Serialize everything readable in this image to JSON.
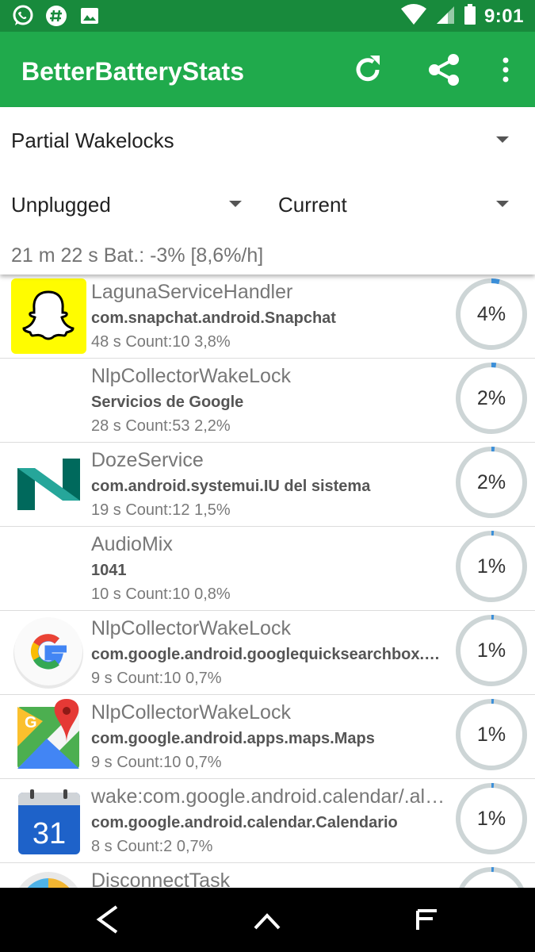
{
  "status_bar": {
    "time": "9:01",
    "left_icons": [
      "whatsapp-icon",
      "hashtag-icon",
      "image-icon"
    ],
    "right_icons": [
      "wifi-icon",
      "signal-icon",
      "battery-icon"
    ]
  },
  "app_bar": {
    "title": "BetterBatteryStats",
    "actions": [
      "refresh-icon",
      "share-icon",
      "more-vert-icon"
    ]
  },
  "filters": {
    "stat_type": "Partial Wakelocks",
    "reference_from": "Unplugged",
    "reference_to": "Current",
    "summary": "21 m 22 s  Bat.: -3% [8,6%/h]"
  },
  "wakelocks": [
    {
      "icon": "snapchat-icon",
      "name": "LagunaServiceHandler",
      "package": "com.snapchat.android.Snapchat",
      "meta": "48 s  Count:10 3,8%",
      "percent_label": "4%",
      "gauge_fraction": 0.038
    },
    {
      "icon": "",
      "name": "NlpCollectorWakeLock",
      "package": "Servicios de Google",
      "meta": "28 s  Count:53 2,2%",
      "percent_label": "2%",
      "gauge_fraction": 0.022
    },
    {
      "icon": "android-n-icon",
      "name": "DozeService",
      "package": "com.android.systemui.IU del sistema",
      "meta": "19 s  Count:12 1,5%",
      "percent_label": "2%",
      "gauge_fraction": 0.015
    },
    {
      "icon": "",
      "name": "AudioMix",
      "package": "1041",
      "meta": "10 s  Count:10 0,8%",
      "percent_label": "1%",
      "gauge_fraction": 0.008
    },
    {
      "icon": "google-icon",
      "name": "NlpCollectorWakeLock",
      "package": "com.google.android.googlequicksearchbox.Google",
      "meta": "9 s  Count:10 0,7%",
      "percent_label": "1%",
      "gauge_fraction": 0.007
    },
    {
      "icon": "google-maps-icon",
      "name": "NlpCollectorWakeLock",
      "package": "com.google.android.apps.maps.Maps",
      "meta": "9 s  Count:10 0,7%",
      "percent_label": "1%",
      "gauge_fraction": 0.007
    },
    {
      "icon": "google-calendar-icon",
      "calendar_day": "31",
      "name": "wake:com.google.android.calendar/.alerts",
      "package": "com.google.android.calendar.Calendario",
      "meta": "8 s  Count:2 0,7%",
      "percent_label": "1%",
      "gauge_fraction": 0.007
    },
    {
      "icon": "disconnect-app-icon",
      "name": "DisconnectTask",
      "package": "",
      "meta": "",
      "percent_label": "",
      "gauge_fraction": 0.007
    }
  ],
  "nav_bar": [
    "back-icon",
    "home-icon",
    "recents-icon"
  ],
  "colors": {
    "status_bar": "#188a3c",
    "app_bar": "#20aa4c",
    "gauge_track": "#cdd5d6",
    "gauge_fill": "#3b8fd9"
  }
}
